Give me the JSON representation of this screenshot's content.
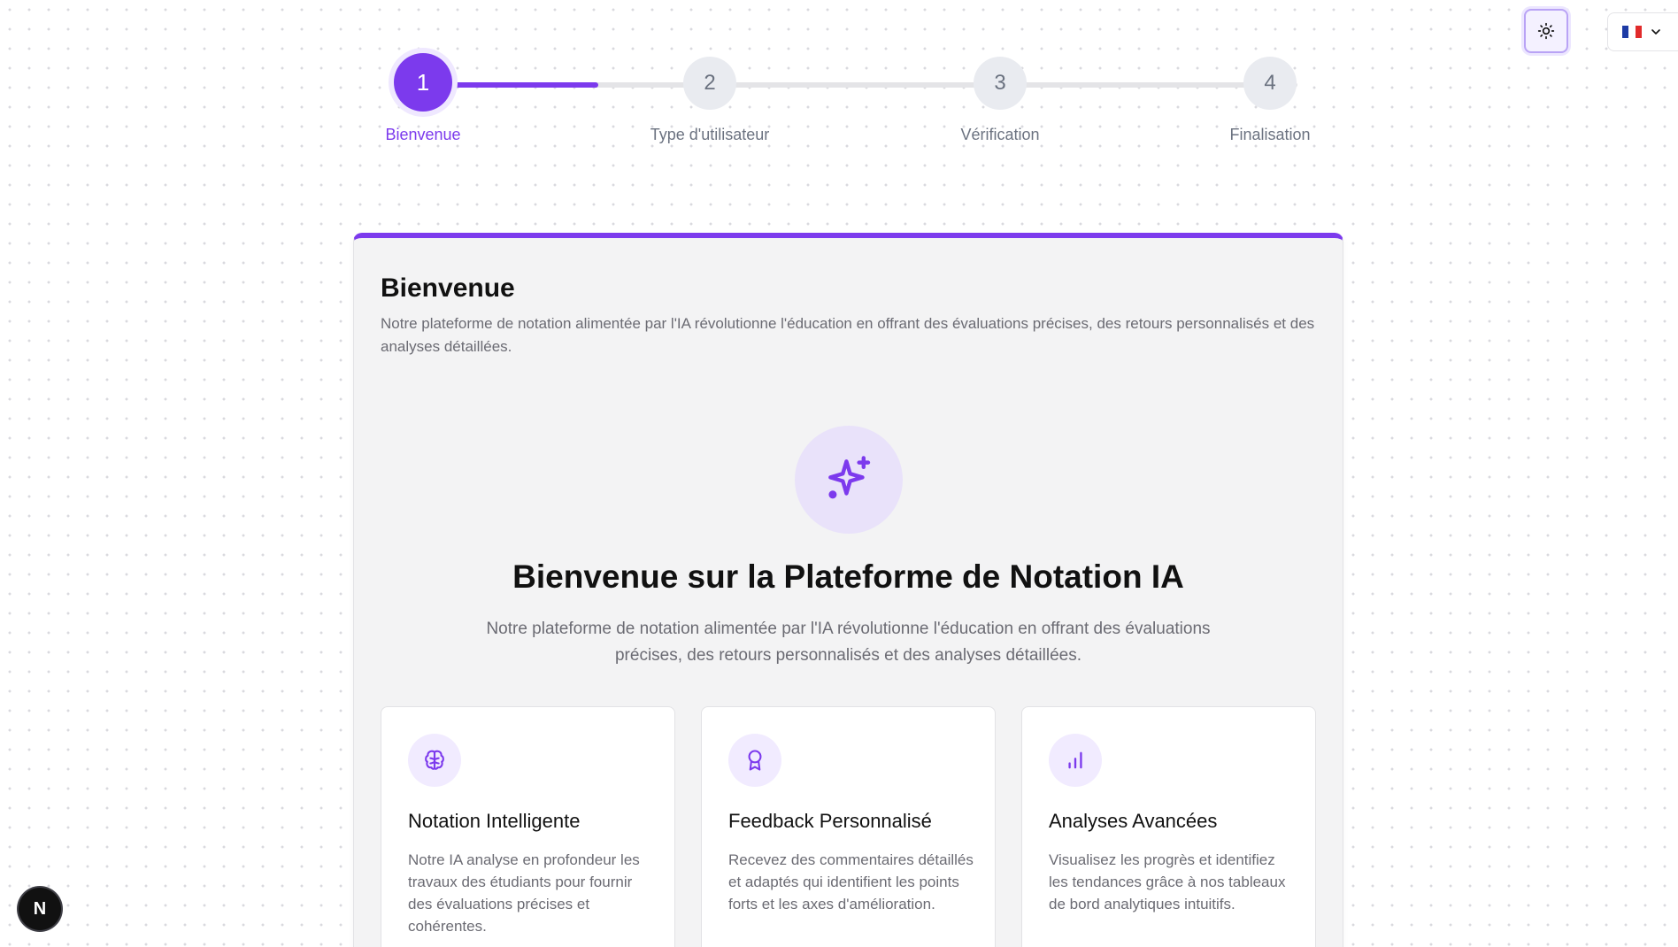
{
  "controls": {
    "theme_icon": "sun-icon",
    "language_flag_colors": [
      "#1d3ba5",
      "#ffffff",
      "#e12b2b"
    ],
    "language_icon": "chevron-down-icon"
  },
  "stepper": {
    "progress": 0.35,
    "accent_color": "#7c3aed",
    "steps": [
      {
        "number": "1",
        "label": "Bienvenue",
        "active": true
      },
      {
        "number": "2",
        "label": "Type d'utilisateur",
        "active": false
      },
      {
        "number": "3",
        "label": "Vérification",
        "active": false
      },
      {
        "number": "4",
        "label": "Finalisation",
        "active": false
      }
    ]
  },
  "card": {
    "title": "Bienvenue",
    "description": "Notre plateforme de notation alimentée par l'IA révolutionne l'éducation en offrant des évaluations précises, des retours personnalisés et des analyses détaillées.",
    "hero_icon": "sparkles-icon",
    "hero_title": "Bienvenue sur la Plateforme de Notation IA",
    "hero_description": "Notre plateforme de notation alimentée par l'IA révolutionne l'éducation en offrant des évaluations précises, des retours personnalisés et des analyses détaillées.",
    "features": [
      {
        "icon": "brain-icon",
        "title": "Notation Intelligente",
        "description": "Notre IA analyse en profondeur les travaux des étudiants pour fournir des évaluations précises et cohérentes."
      },
      {
        "icon": "award-icon",
        "title": "Feedback Personnalisé",
        "description": "Recevez des commentaires détaillés et adaptés qui identifient les points forts et les axes d'amélioration."
      },
      {
        "icon": "bar-chart-icon",
        "title": "Analyses Avancées",
        "description": "Visualisez les progrès et identifiez les tendances grâce à nos tableaux de bord analytiques intuitifs."
      }
    ]
  },
  "badge": {
    "letter": "N"
  }
}
